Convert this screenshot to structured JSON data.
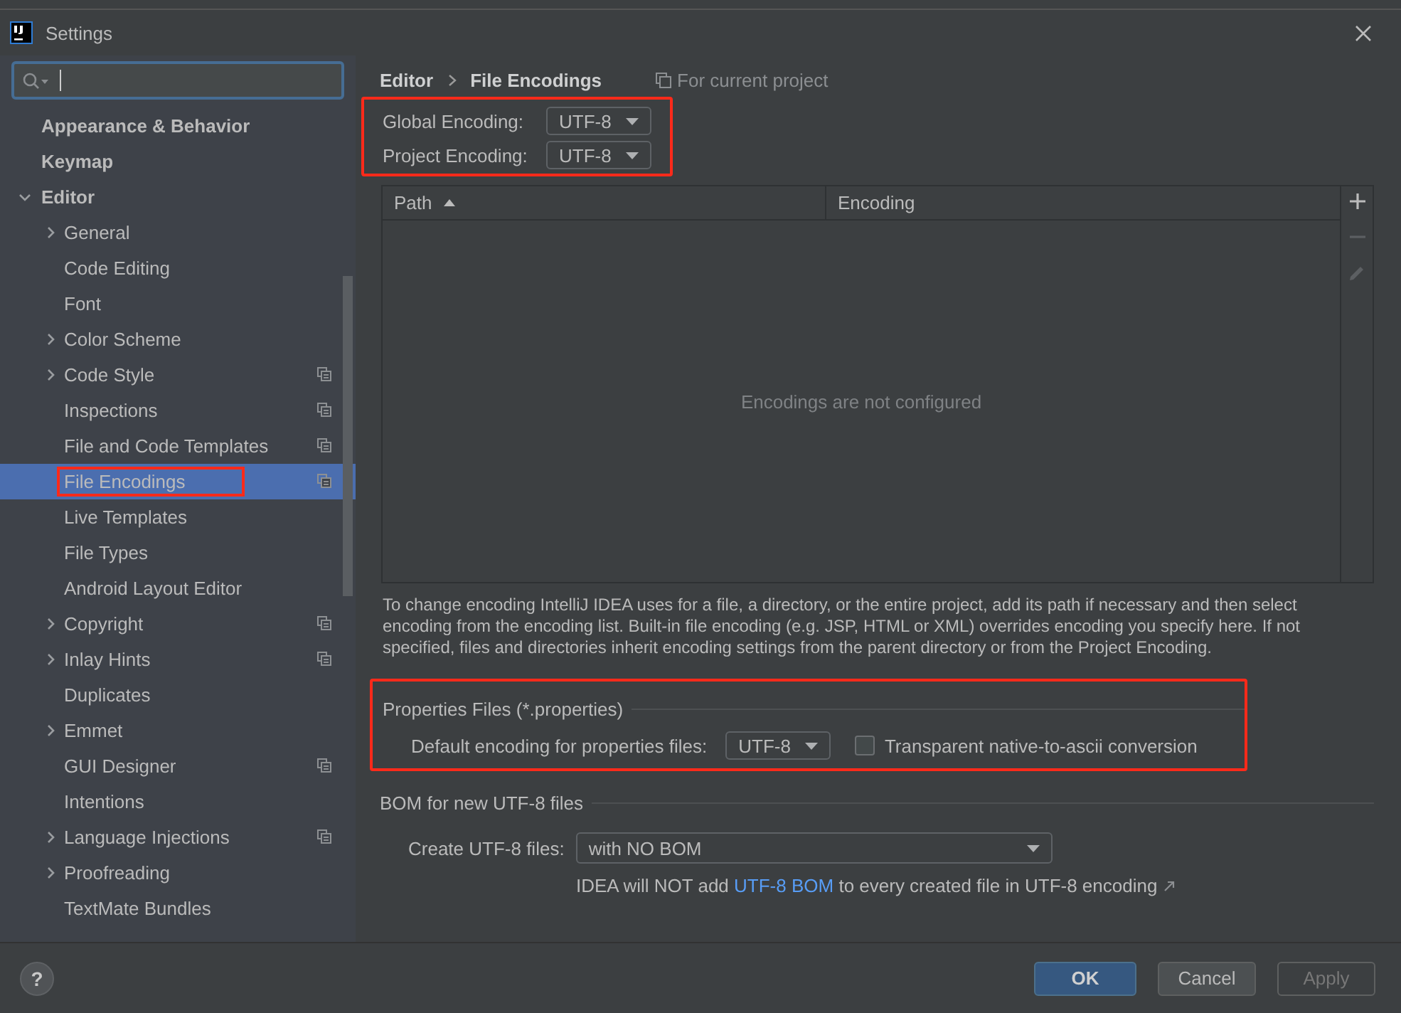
{
  "window": {
    "title": "Settings"
  },
  "sidebar": {
    "items": [
      {
        "label": "Appearance & Behavior",
        "kind": "group"
      },
      {
        "label": "Keymap",
        "kind": "group"
      },
      {
        "label": "Editor",
        "kind": "branch",
        "expanded": true,
        "children": [
          {
            "label": "General",
            "expandable": true,
            "project_scope": false,
            "selected": false,
            "highlighted": false
          },
          {
            "label": "Code Editing",
            "expandable": false,
            "project_scope": false,
            "selected": false,
            "highlighted": false
          },
          {
            "label": "Font",
            "expandable": false,
            "project_scope": false,
            "selected": false,
            "highlighted": false
          },
          {
            "label": "Color Scheme",
            "expandable": true,
            "project_scope": false,
            "selected": false,
            "highlighted": false
          },
          {
            "label": "Code Style",
            "expandable": true,
            "project_scope": true,
            "selected": false,
            "highlighted": false
          },
          {
            "label": "Inspections",
            "expandable": false,
            "project_scope": true,
            "selected": false,
            "highlighted": false
          },
          {
            "label": "File and Code Templates",
            "expandable": false,
            "project_scope": true,
            "selected": false,
            "highlighted": false
          },
          {
            "label": "File Encodings",
            "expandable": false,
            "project_scope": true,
            "selected": true,
            "highlighted": true
          },
          {
            "label": "Live Templates",
            "expandable": false,
            "project_scope": false,
            "selected": false,
            "highlighted": false
          },
          {
            "label": "File Types",
            "expandable": false,
            "project_scope": false,
            "selected": false,
            "highlighted": false
          },
          {
            "label": "Android Layout Editor",
            "expandable": false,
            "project_scope": false,
            "selected": false,
            "highlighted": false
          },
          {
            "label": "Copyright",
            "expandable": true,
            "project_scope": true,
            "selected": false,
            "highlighted": false
          },
          {
            "label": "Inlay Hints",
            "expandable": true,
            "project_scope": true,
            "selected": false,
            "highlighted": false
          },
          {
            "label": "Duplicates",
            "expandable": false,
            "project_scope": false,
            "selected": false,
            "highlighted": false
          },
          {
            "label": "Emmet",
            "expandable": true,
            "project_scope": false,
            "selected": false,
            "highlighted": false
          },
          {
            "label": "GUI Designer",
            "expandable": false,
            "project_scope": true,
            "selected": false,
            "highlighted": false
          },
          {
            "label": "Intentions",
            "expandable": false,
            "project_scope": false,
            "selected": false,
            "highlighted": false
          },
          {
            "label": "Language Injections",
            "expandable": true,
            "project_scope": true,
            "selected": false,
            "highlighted": false
          },
          {
            "label": "Proofreading",
            "expandable": true,
            "project_scope": false,
            "selected": false,
            "highlighted": false
          },
          {
            "label": "TextMate Bundles",
            "expandable": false,
            "project_scope": false,
            "selected": false,
            "highlighted": false
          }
        ]
      }
    ]
  },
  "breadcrumb": [
    "Editor",
    "File Encodings"
  ],
  "scope_note": "For current project",
  "encodings": {
    "highlighted": true,
    "rows": [
      {
        "label": "Global Encoding:",
        "value": "UTF-8"
      },
      {
        "label": "Project Encoding:",
        "value": "UTF-8"
      }
    ]
  },
  "table": {
    "columns": [
      {
        "label": "Path",
        "sorted": true
      },
      {
        "label": "Encoding",
        "sorted": false
      }
    ],
    "empty_text": "Encodings are not configured",
    "toolbar": [
      {
        "kind": "add",
        "disabled": false
      },
      {
        "kind": "remove",
        "disabled": true
      },
      {
        "kind": "edit",
        "disabled": true
      }
    ]
  },
  "description": "To change encoding IntelliJ IDEA uses for a file, a directory, or the entire project, add its path if necessary and then select encoding from the encoding list. Built-in file encoding (e.g. JSP, HTML or XML) overrides encoding you specify here. If not specified, files and directories inherit encoding settings from the parent directory or from the Project Encoding.",
  "properties": {
    "title": "Properties Files (*.properties)",
    "highlighted": true,
    "label": "Default encoding for properties files:",
    "value": "UTF-8",
    "checkbox": {
      "label": "Transparent native-to-ascii conversion",
      "checked": false
    }
  },
  "bom": {
    "title": "BOM for new UTF-8 files",
    "label": "Create UTF-8 files:",
    "value": "with NO BOM",
    "note_before": "IDEA will NOT add",
    "link": "UTF-8 BOM",
    "note_after": "to every created file in UTF-8 encoding"
  },
  "help": "?",
  "buttons": [
    {
      "label": "OK",
      "kind": "primary",
      "disabled": false
    },
    {
      "label": "Cancel",
      "kind": "normal",
      "disabled": false
    },
    {
      "label": "Apply",
      "kind": "normal",
      "disabled": true
    }
  ]
}
